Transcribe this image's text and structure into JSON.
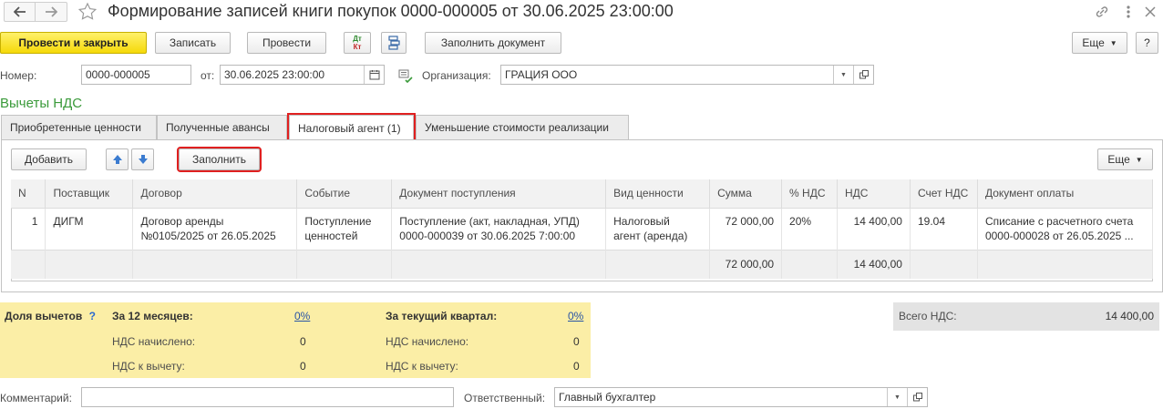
{
  "window": {
    "title": "Формирование записей книги покупок 0000-000005 от 30.06.2025 23:00:00"
  },
  "toolbar": {
    "post_close": "Провести и закрыть",
    "save": "Записать",
    "post": "Провести",
    "dtkt_top": "Дт",
    "dtkt_bottom": "Кт",
    "fill_doc": "Заполнить документ",
    "more": "Еще",
    "help": "?"
  },
  "header": {
    "number_label": "Номер:",
    "number_value": "0000-000005",
    "date_label": "от:",
    "date_value": "30.06.2025 23:00:00",
    "org_label": "Организация:",
    "org_value": "ГРАЦИЯ ООО"
  },
  "section_title": "Вычеты НДС",
  "tabs": [
    {
      "label": "Приобретенные ценности"
    },
    {
      "label": "Полученные авансы"
    },
    {
      "label": "Налоговый агент (1)"
    },
    {
      "label": "Уменьшение стоимости реализации"
    }
  ],
  "grid_toolbar": {
    "add": "Добавить",
    "fill": "Заполнить",
    "more": "Еще"
  },
  "table": {
    "columns": [
      "N",
      "Поставщик",
      "Договор",
      "Событие",
      "Документ поступления",
      "Вид ценности",
      "Сумма",
      "% НДС",
      "НДС",
      "Счет НДС",
      "Документ оплаты"
    ],
    "rows": [
      {
        "n": "1",
        "supplier": "ДИГМ",
        "contract_1": "Договор аренды",
        "contract_2": "№0105/2025 от 26.05.2025",
        "event_1": "Поступление",
        "event_2": "ценностей",
        "receipt_1": "Поступление (акт, накладная, УПД)",
        "receipt_2": "0000-000039 от 30.06.2025 7:00:00",
        "kind_1": "Налоговый",
        "kind_2": "агент (аренда)",
        "sum": "72 000,00",
        "vat_rate": "20%",
        "vat": "14 400,00",
        "vat_account": "19.04",
        "payment_1": "Списание с расчетного счета",
        "payment_2": "0000-000028 от 26.05.2025 ..."
      }
    ],
    "totals": {
      "sum": "72 000,00",
      "vat": "14 400,00"
    }
  },
  "summary": {
    "share_label": "Доля вычетов",
    "share_help": "?",
    "months12_label": "За 12 месяцев:",
    "months12_value": "0%",
    "quarter_label": "За текущий квартал:",
    "quarter_value": "0%",
    "accrued_label": "НДС начислено:",
    "deduct_label": "НДС к вычету:",
    "m12_accrued": "0",
    "m12_deduct": "0",
    "q_accrued": "0",
    "q_deduct": "0",
    "total_label": "Всего НДС:",
    "total_value": "14 400,00"
  },
  "footer": {
    "comment_label": "Комментарий:",
    "comment_value": "",
    "responsible_label": "Ответственный:",
    "responsible_value": "Главный бухгалтер"
  },
  "colors": {
    "section_title": "#3a9a3a",
    "highlight_red": "#e02020",
    "summary_bg": "#fbeea6",
    "primary_button": "#f5d90a"
  }
}
